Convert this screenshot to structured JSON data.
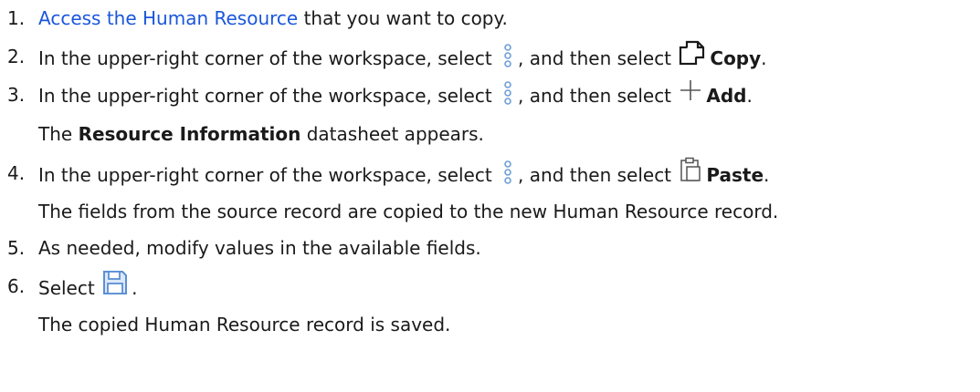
{
  "steps": [
    {
      "number": "1.",
      "link_text": "Access the Human Resource",
      "text_after": " that you want to copy."
    },
    {
      "number": "2.",
      "text_before": "In the upper-right corner of the workspace, select ",
      "text_middle": ", and then select ",
      "action_label": "Copy",
      "text_end": ".",
      "icon_more": "more-options-icon",
      "icon_action": "copy-icon"
    },
    {
      "number": "3.",
      "text_before": "In the upper-right corner of the workspace, select ",
      "text_middle": ", and then select ",
      "action_label": "Add",
      "text_end": ".",
      "icon_more": "more-options-icon",
      "icon_action": "add-icon",
      "result_prefix": "The ",
      "result_bold": "Resource Information",
      "result_suffix": " datasheet appears."
    },
    {
      "number": "4.",
      "text_before": "In the upper-right corner of the workspace, select ",
      "text_middle": ", and then select ",
      "action_label": "Paste",
      "text_end": ".",
      "icon_more": "more-options-icon",
      "icon_action": "paste-icon",
      "result_text": "The fields from the source record are copied to the new Human Resource record."
    },
    {
      "number": "5.",
      "text": "As needed, modify values in the available fields."
    },
    {
      "number": "6.",
      "text_before": "Select ",
      "text_end": ".",
      "icon_action": "save-icon",
      "result_text": "The copied Human Resource record is saved."
    }
  ],
  "colors": {
    "link": "#1a56db",
    "icon_blue": "#6e9fd8",
    "text": "#1a1a1a"
  }
}
